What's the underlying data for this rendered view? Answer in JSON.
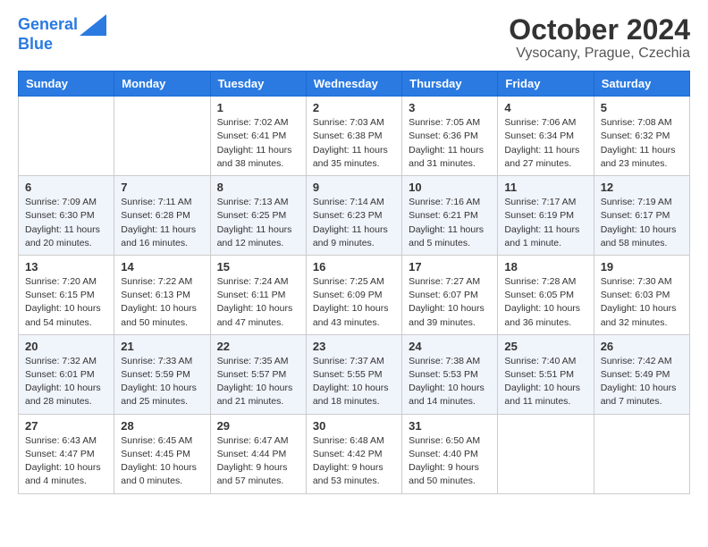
{
  "header": {
    "logo_line1": "General",
    "logo_line2": "Blue",
    "title": "October 2024",
    "subtitle": "Vysocany, Prague, Czechia"
  },
  "calendar": {
    "days_of_week": [
      "Sunday",
      "Monday",
      "Tuesday",
      "Wednesday",
      "Thursday",
      "Friday",
      "Saturday"
    ],
    "weeks": [
      [
        {
          "day": "",
          "info": ""
        },
        {
          "day": "",
          "info": ""
        },
        {
          "day": "1",
          "info": "Sunrise: 7:02 AM\nSunset: 6:41 PM\nDaylight: 11 hours and 38 minutes."
        },
        {
          "day": "2",
          "info": "Sunrise: 7:03 AM\nSunset: 6:38 PM\nDaylight: 11 hours and 35 minutes."
        },
        {
          "day": "3",
          "info": "Sunrise: 7:05 AM\nSunset: 6:36 PM\nDaylight: 11 hours and 31 minutes."
        },
        {
          "day": "4",
          "info": "Sunrise: 7:06 AM\nSunset: 6:34 PM\nDaylight: 11 hours and 27 minutes."
        },
        {
          "day": "5",
          "info": "Sunrise: 7:08 AM\nSunset: 6:32 PM\nDaylight: 11 hours and 23 minutes."
        }
      ],
      [
        {
          "day": "6",
          "info": "Sunrise: 7:09 AM\nSunset: 6:30 PM\nDaylight: 11 hours and 20 minutes."
        },
        {
          "day": "7",
          "info": "Sunrise: 7:11 AM\nSunset: 6:28 PM\nDaylight: 11 hours and 16 minutes."
        },
        {
          "day": "8",
          "info": "Sunrise: 7:13 AM\nSunset: 6:25 PM\nDaylight: 11 hours and 12 minutes."
        },
        {
          "day": "9",
          "info": "Sunrise: 7:14 AM\nSunset: 6:23 PM\nDaylight: 11 hours and 9 minutes."
        },
        {
          "day": "10",
          "info": "Sunrise: 7:16 AM\nSunset: 6:21 PM\nDaylight: 11 hours and 5 minutes."
        },
        {
          "day": "11",
          "info": "Sunrise: 7:17 AM\nSunset: 6:19 PM\nDaylight: 11 hours and 1 minute."
        },
        {
          "day": "12",
          "info": "Sunrise: 7:19 AM\nSunset: 6:17 PM\nDaylight: 10 hours and 58 minutes."
        }
      ],
      [
        {
          "day": "13",
          "info": "Sunrise: 7:20 AM\nSunset: 6:15 PM\nDaylight: 10 hours and 54 minutes."
        },
        {
          "day": "14",
          "info": "Sunrise: 7:22 AM\nSunset: 6:13 PM\nDaylight: 10 hours and 50 minutes."
        },
        {
          "day": "15",
          "info": "Sunrise: 7:24 AM\nSunset: 6:11 PM\nDaylight: 10 hours and 47 minutes."
        },
        {
          "day": "16",
          "info": "Sunrise: 7:25 AM\nSunset: 6:09 PM\nDaylight: 10 hours and 43 minutes."
        },
        {
          "day": "17",
          "info": "Sunrise: 7:27 AM\nSunset: 6:07 PM\nDaylight: 10 hours and 39 minutes."
        },
        {
          "day": "18",
          "info": "Sunrise: 7:28 AM\nSunset: 6:05 PM\nDaylight: 10 hours and 36 minutes."
        },
        {
          "day": "19",
          "info": "Sunrise: 7:30 AM\nSunset: 6:03 PM\nDaylight: 10 hours and 32 minutes."
        }
      ],
      [
        {
          "day": "20",
          "info": "Sunrise: 7:32 AM\nSunset: 6:01 PM\nDaylight: 10 hours and 28 minutes."
        },
        {
          "day": "21",
          "info": "Sunrise: 7:33 AM\nSunset: 5:59 PM\nDaylight: 10 hours and 25 minutes."
        },
        {
          "day": "22",
          "info": "Sunrise: 7:35 AM\nSunset: 5:57 PM\nDaylight: 10 hours and 21 minutes."
        },
        {
          "day": "23",
          "info": "Sunrise: 7:37 AM\nSunset: 5:55 PM\nDaylight: 10 hours and 18 minutes."
        },
        {
          "day": "24",
          "info": "Sunrise: 7:38 AM\nSunset: 5:53 PM\nDaylight: 10 hours and 14 minutes."
        },
        {
          "day": "25",
          "info": "Sunrise: 7:40 AM\nSunset: 5:51 PM\nDaylight: 10 hours and 11 minutes."
        },
        {
          "day": "26",
          "info": "Sunrise: 7:42 AM\nSunset: 5:49 PM\nDaylight: 10 hours and 7 minutes."
        }
      ],
      [
        {
          "day": "27",
          "info": "Sunrise: 6:43 AM\nSunset: 4:47 PM\nDaylight: 10 hours and 4 minutes."
        },
        {
          "day": "28",
          "info": "Sunrise: 6:45 AM\nSunset: 4:45 PM\nDaylight: 10 hours and 0 minutes."
        },
        {
          "day": "29",
          "info": "Sunrise: 6:47 AM\nSunset: 4:44 PM\nDaylight: 9 hours and 57 minutes."
        },
        {
          "day": "30",
          "info": "Sunrise: 6:48 AM\nSunset: 4:42 PM\nDaylight: 9 hours and 53 minutes."
        },
        {
          "day": "31",
          "info": "Sunrise: 6:50 AM\nSunset: 4:40 PM\nDaylight: 9 hours and 50 minutes."
        },
        {
          "day": "",
          "info": ""
        },
        {
          "day": "",
          "info": ""
        }
      ]
    ]
  }
}
